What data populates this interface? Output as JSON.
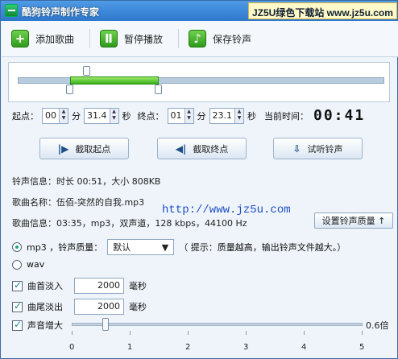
{
  "window": {
    "title": "酷狗铃声制作专家",
    "brand": "JZ5U绿色下载站 www.jz5u.com"
  },
  "toolbar": {
    "add_song": "添加歌曲",
    "pause": "暂停播放",
    "save": "保存铃声"
  },
  "time": {
    "start_label": "起点：",
    "start_min": "00",
    "start_sec": "31.4",
    "end_label": "终点：",
    "end_min": "01",
    "end_sec": "23.1",
    "min_unit": "分",
    "sec_unit": "秒",
    "current_label": "当前时间：",
    "current_value": "00:41"
  },
  "actions": {
    "capture_start": "截取起点",
    "capture_end": "截取终点",
    "preview": "试听铃声"
  },
  "info": {
    "ringtone_info": "铃声信息：时长 00:51，大小 808KB",
    "song_name": "歌曲名称：伍佰-突然的自我.mp3",
    "song_info": "歌曲信息：03:35，mp3，双声道，128 kbps，44100 Hz",
    "watermark": "http://www.jz5u.com",
    "quality_button": "设置铃声质量 ↑"
  },
  "format": {
    "mp3_label": "mp3 ，铃声质量：",
    "quality_value": "默认",
    "hint": "（ 提示：质量越高，输出铃声文件越大。）",
    "wav_label": "wav"
  },
  "effects": {
    "fade_in_label": "曲首淡入",
    "fade_in_value": "2000",
    "fade_out_label": "曲尾淡出",
    "fade_out_value": "2000",
    "ms_unit": "毫秒",
    "volume_label": "声音增大",
    "volume_value": "0.6倍",
    "volume_level": 0.6,
    "scale": [
      "0",
      "1",
      "2",
      "3",
      "4",
      "5"
    ]
  },
  "colors": {
    "titlebar": "#2f77cc",
    "range": "#37b31a",
    "watermark": "#1e4fc4"
  }
}
